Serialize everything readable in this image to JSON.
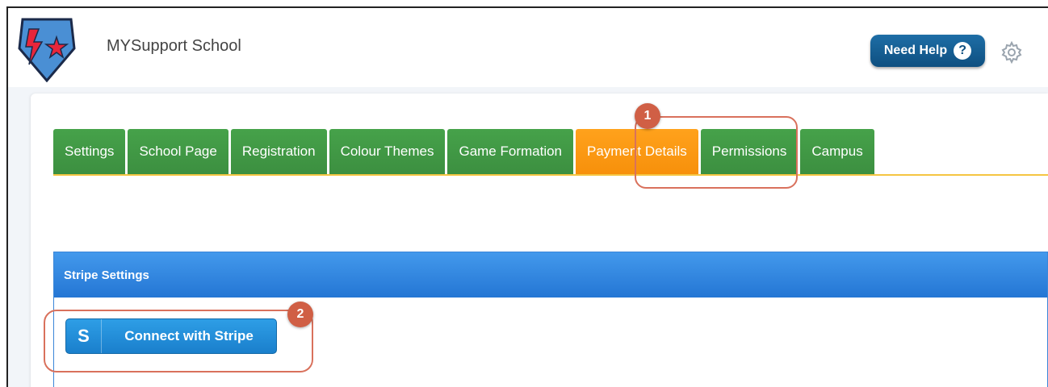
{
  "header": {
    "app_title": "MYSupport School",
    "help_label": "Need Help",
    "help_icon": "?"
  },
  "tabs": [
    {
      "label": "Settings"
    },
    {
      "label": "School Page"
    },
    {
      "label": "Registration"
    },
    {
      "label": "Colour Themes"
    },
    {
      "label": "Game Formation"
    },
    {
      "label": "Payment Details",
      "active": true
    },
    {
      "label": "Permissions"
    },
    {
      "label": "Campus"
    }
  ],
  "callouts": {
    "one": "1",
    "two": "2"
  },
  "stripe": {
    "section_title": "Stripe Settings",
    "button_icon": "S",
    "button_label": "Connect with Stripe"
  },
  "colors": {
    "tab_green": "#46a24a",
    "tab_active_orange": "#ffa21c",
    "help_blue": "#0e4f80",
    "stripe_blue": "#2476d4",
    "callout_red": "#d05f45"
  },
  "icons": {
    "logo": "school-shield-logo-icon",
    "gear": "gear-icon",
    "help": "question-circle-icon"
  }
}
